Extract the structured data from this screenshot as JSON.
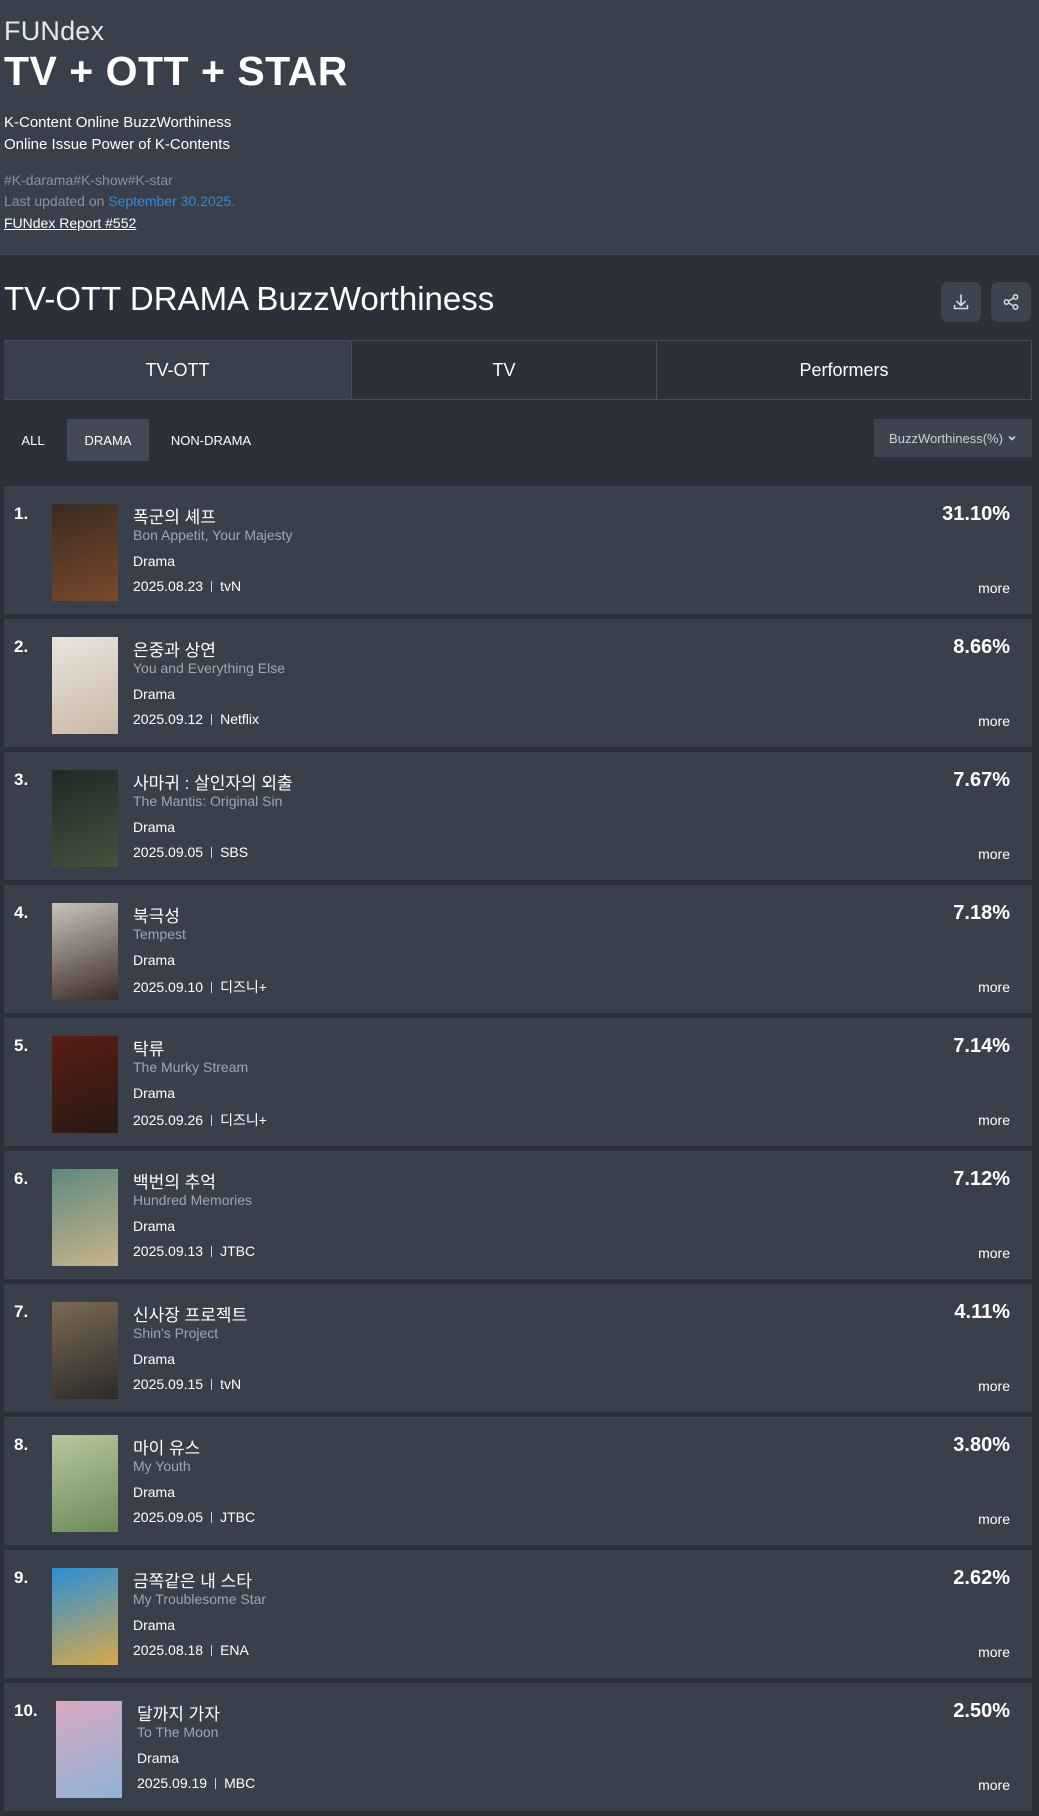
{
  "header": {
    "brand": "FUNdex",
    "title": "TV + OTT + STAR",
    "subtitle1": "K-Content Online BuzzWorthiness",
    "subtitle2": "Online Issue Power of K-Contents",
    "tags": "#K-darama#K-show#K-star",
    "updated_prefix": "Last updated on ",
    "updated_date": "September 30.2025.",
    "report_link": "FUNdex Report #552"
  },
  "section": {
    "title": "TV-OTT DRAMA BuzzWorthiness",
    "download_icon": "download-icon",
    "share_icon": "share-icon",
    "tabs": [
      "TV-OTT",
      "TV",
      "Performers"
    ],
    "active_tab": "TV-OTT",
    "filters": [
      "ALL",
      "DRAMA",
      "NON-DRAMA"
    ],
    "active_filter": "DRAMA",
    "sort_label": "BuzzWorthiness(%)"
  },
  "rankings": [
    {
      "rank": "1.",
      "title_ko": "폭군의 셰프",
      "title_en": "Bon Appetit, Your Majesty",
      "genre": "Drama",
      "date": "2025.08.23",
      "channel": "tvN",
      "percent": "31.10%",
      "more": "more",
      "poster_colors": [
        "#3a2a22",
        "#7a4a2c"
      ]
    },
    {
      "rank": "2.",
      "title_ko": "은중과 상연",
      "title_en": "You and Everything Else",
      "genre": "Drama",
      "date": "2025.09.12",
      "channel": "Netflix",
      "percent": "8.66%",
      "more": "more",
      "poster_colors": [
        "#e9e4dc",
        "#c9b8a6"
      ]
    },
    {
      "rank": "3.",
      "title_ko": "사마귀 : 살인자의 외출",
      "title_en": "The Mantis: Original Sin",
      "genre": "Drama",
      "date": "2025.09.05",
      "channel": "SBS",
      "percent": "7.67%",
      "more": "more",
      "poster_colors": [
        "#1f2a26",
        "#46523e"
      ]
    },
    {
      "rank": "4.",
      "title_ko": "북극성",
      "title_en": "Tempest",
      "genre": "Drama",
      "date": "2025.09.10",
      "channel": "디즈니+",
      "percent": "7.18%",
      "more": "more",
      "poster_colors": [
        "#c9c3bb",
        "#3b2a26"
      ]
    },
    {
      "rank": "5.",
      "title_ko": "탁류",
      "title_en": "The Murky Stream",
      "genre": "Drama",
      "date": "2025.09.26",
      "channel": "디즈니+",
      "percent": "7.14%",
      "more": "more",
      "poster_colors": [
        "#5a1c16",
        "#2a1a14"
      ]
    },
    {
      "rank": "6.",
      "title_ko": "백번의 추억",
      "title_en": "Hundred Memories",
      "genre": "Drama",
      "date": "2025.09.13",
      "channel": "JTBC",
      "percent": "7.12%",
      "more": "more",
      "poster_colors": [
        "#5e8a7e",
        "#c9b38a"
      ]
    },
    {
      "rank": "7.",
      "title_ko": "신사장 프로젝트",
      "title_en": "Shin's Project",
      "genre": "Drama",
      "date": "2025.09.15",
      "channel": "tvN",
      "percent": "4.11%",
      "more": "more",
      "poster_colors": [
        "#7a6a55",
        "#2c2a28"
      ]
    },
    {
      "rank": "8.",
      "title_ko": "마이 유스",
      "title_en": "My Youth",
      "genre": "Drama",
      "date": "2025.09.05",
      "channel": "JTBC",
      "percent": "3.80%",
      "more": "more",
      "poster_colors": [
        "#b7c79e",
        "#6d8a5a"
      ]
    },
    {
      "rank": "9.",
      "title_ko": "금쪽같은 내 스타",
      "title_en": "My Troublesome Star",
      "genre": "Drama",
      "date": "2025.08.18",
      "channel": "ENA",
      "percent": "2.62%",
      "more": "more",
      "poster_colors": [
        "#2a8fd6",
        "#d9a84a"
      ]
    },
    {
      "rank": "10.",
      "title_ko": "달까지 가자",
      "title_en": "To The Moon",
      "genre": "Drama",
      "date": "2025.09.19",
      "channel": "MBC",
      "percent": "2.50%",
      "more": "more",
      "poster_colors": [
        "#d9a7c0",
        "#8fb3d6"
      ]
    }
  ]
}
